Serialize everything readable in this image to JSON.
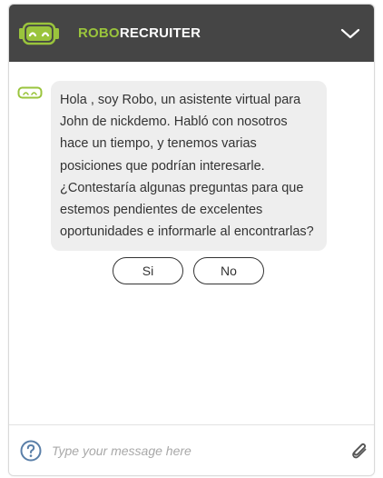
{
  "header": {
    "brand_prefix": "ROBO",
    "brand_suffix": "RECRUITER",
    "logo_icon": "robot-face-icon",
    "collapse_icon": "chevron-down-icon"
  },
  "conversation": {
    "bot_avatar_icon": "robot-face-icon",
    "messages": [
      {
        "sender": "bot",
        "text": "Hola , soy Robo, un asistente virtual para John de nickdemo. Habló con nosotros hace un tiempo, y tenemos varias posiciones que podrían interesarle. ¿Contestaría algunas preguntas para que estemos pendientes de excelentes oportunidades e informarle al encontrarlas?"
      }
    ],
    "quick_replies": [
      "Si",
      "No"
    ]
  },
  "composer": {
    "placeholder": "Type your message here",
    "value": "",
    "help_icon": "question-circle-icon",
    "attach_icon": "paperclip-icon"
  },
  "colors": {
    "header_bg": "#454545",
    "brand_accent": "#9ac43c",
    "bubble_bg": "#eeeeee",
    "help_icon": "#5a7fa8"
  }
}
